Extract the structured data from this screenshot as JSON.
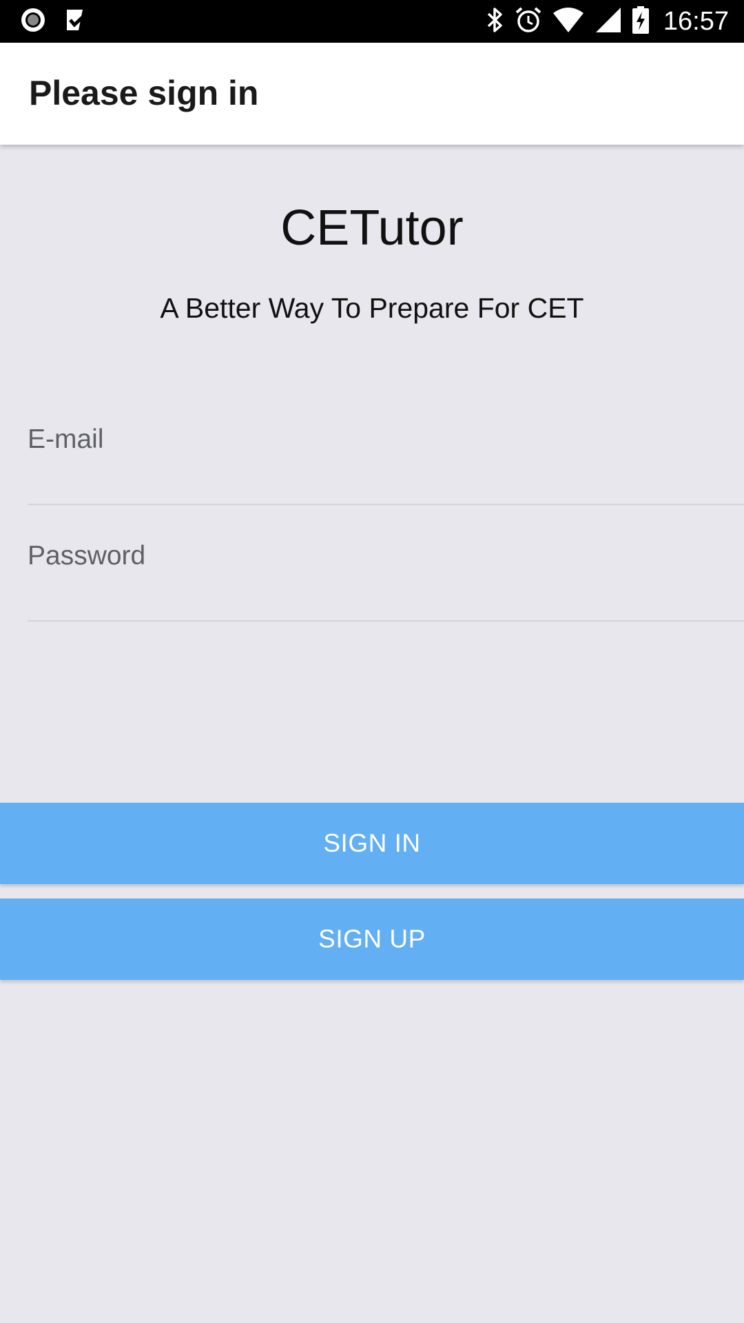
{
  "status_bar": {
    "time": "16:57",
    "left_icons": [
      "record-icon",
      "check-notification-icon"
    ],
    "right_icons": [
      "bluetooth-icon",
      "alarm-icon",
      "wifi-icon",
      "signal-icon",
      "battery-charging-icon"
    ]
  },
  "app_bar": {
    "title": "Please sign in"
  },
  "brand": {
    "name": "CETutor",
    "tagline": "A Better Way To Prepare For CET"
  },
  "form": {
    "email_placeholder": "E-mail",
    "email_value": "",
    "password_placeholder": "Password",
    "password_value": ""
  },
  "actions": {
    "sign_in_label": "SIGN IN",
    "sign_up_label": "SIGN UP"
  },
  "colors": {
    "background": "#e8e7ee",
    "button": "#62aff3",
    "button_text": "#ffffff",
    "app_bar": "#ffffff",
    "status_bar": "#000000"
  }
}
